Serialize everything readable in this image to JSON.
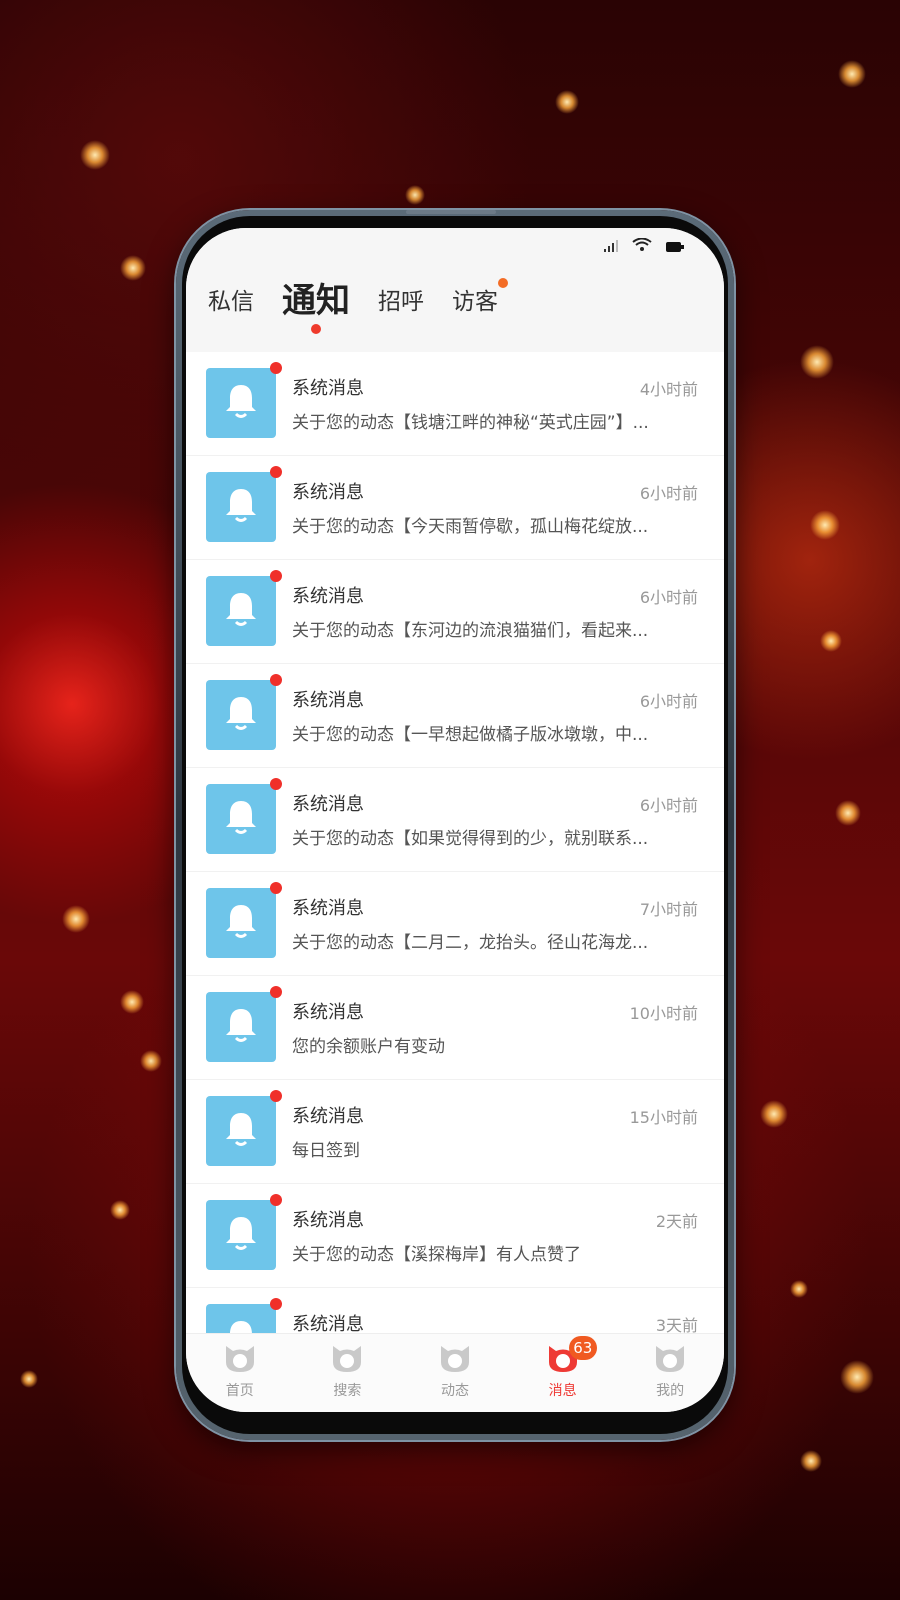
{
  "tabs": [
    {
      "label": "私信"
    },
    {
      "label": "通知"
    },
    {
      "label": "招呼"
    },
    {
      "label": "访客"
    }
  ],
  "active_tab": "通知",
  "notifications": [
    {
      "title": "系统消息",
      "time": "4小时前",
      "desc": "关于您的动态【钱塘江畔的神秘“英式庄园”】..."
    },
    {
      "title": "系统消息",
      "time": "6小时前",
      "desc": "关于您的动态【今天雨暂停歇，孤山梅花绽放..."
    },
    {
      "title": "系统消息",
      "time": "6小时前",
      "desc": "关于您的动态【东河边的流浪猫猫们，看起来..."
    },
    {
      "title": "系统消息",
      "time": "6小时前",
      "desc": "关于您的动态【一早想起做橘子版冰墩墩，中..."
    },
    {
      "title": "系统消息",
      "time": "6小时前",
      "desc": "关于您的动态【如果觉得得到的少，就别联系..."
    },
    {
      "title": "系统消息",
      "time": "7小时前",
      "desc": "关于您的动态【二月二，龙抬头。径山花海龙..."
    },
    {
      "title": "系统消息",
      "time": "10小时前",
      "desc": "您的余额账户有变动"
    },
    {
      "title": "系统消息",
      "time": "15小时前",
      "desc": "每日签到"
    },
    {
      "title": "系统消息",
      "time": "2天前",
      "desc": "关于您的动态【溪探梅岸】有人点赞了"
    },
    {
      "title": "系统消息",
      "time": "3天前",
      "desc": ""
    }
  ],
  "tabbar": [
    {
      "label": "首页",
      "icon": "home-cat-icon"
    },
    {
      "label": "搜索",
      "icon": "search-cat-icon"
    },
    {
      "label": "动态",
      "icon": "feed-cat-icon"
    },
    {
      "label": "消息",
      "icon": "message-cat-icon",
      "badge": "63"
    },
    {
      "label": "我的",
      "icon": "profile-cat-icon"
    }
  ],
  "colors": {
    "accent": "#ef3b2c",
    "avatar_bg": "#6ec5ea",
    "badge": "#f05a21"
  }
}
